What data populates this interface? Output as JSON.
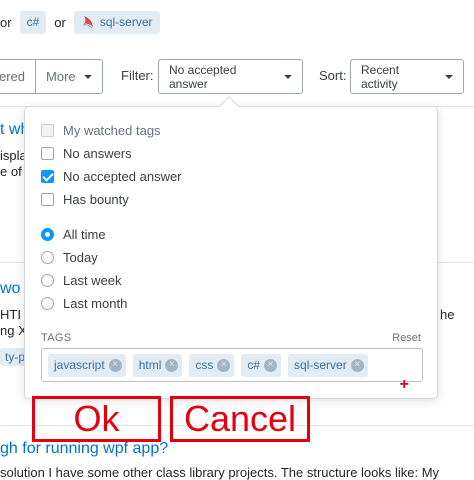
{
  "tagline": {
    "prefix": "or",
    "tag_csharp": "c#",
    "joiner": "or",
    "tag_sql": "sql-server"
  },
  "toolbar": {
    "seg_partial": "ered",
    "more_label": "More",
    "filter_label": "Filter:",
    "filter_value": "No accepted answer",
    "sort_label": "Sort:",
    "sort_value": "Recent activity"
  },
  "background": {
    "q1_title": "t wh",
    "q1_line1": "ispla",
    "q1_line2": "e of",
    "q2_title": "wo",
    "q2_line1": "HTI",
    "q2_line2": "ng X",
    "q2_line1_right": "he",
    "q2_tag": "ty-pa",
    "q3_title": "gh for running wpf app?",
    "q3_line1": "solution I have some other class library projects. The structure looks like: My"
  },
  "filter_popover": {
    "checkboxes": [
      {
        "label": "My watched tags",
        "checked": false,
        "disabled": true
      },
      {
        "label": "No answers",
        "checked": false,
        "disabled": false
      },
      {
        "label": "No accepted answer",
        "checked": true,
        "disabled": false
      },
      {
        "label": "Has bounty",
        "checked": false,
        "disabled": false
      }
    ],
    "radios": [
      {
        "label": "All time",
        "selected": true
      },
      {
        "label": "Today",
        "selected": false
      },
      {
        "label": "Last week",
        "selected": false
      },
      {
        "label": "Last month",
        "selected": false
      }
    ],
    "tags_header": "TAGS",
    "reset_label": "Reset",
    "tags": [
      "javascript",
      "html",
      "css",
      "c#",
      "sql-server"
    ],
    "add_symbol": "+"
  },
  "overlay": {
    "ok_label": "Ok",
    "cancel_label": "Cancel"
  },
  "colors": {
    "accent": "#0a95ff",
    "tag_bg": "#e1ecf4",
    "tag_fg": "#39739d",
    "overlay_red": "#e3000f"
  }
}
